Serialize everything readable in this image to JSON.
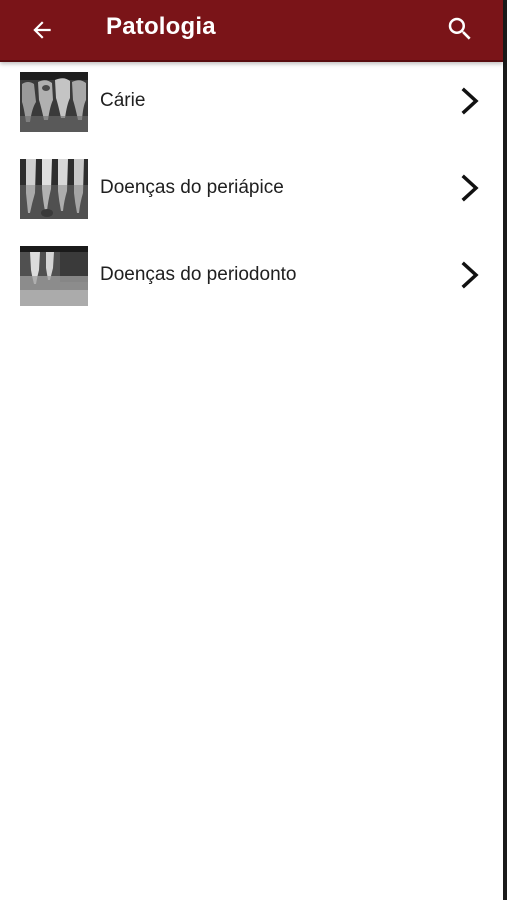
{
  "header": {
    "title": "Patologia",
    "back_icon": "arrow-left-icon",
    "search_icon": "search-icon"
  },
  "list": {
    "items": [
      {
        "label": "Cárie",
        "thumbnail": "xray-caries-thumbnail"
      },
      {
        "label": "Doenças do periápice",
        "thumbnail": "xray-periapex-thumbnail"
      },
      {
        "label": "Doenças do periodonto",
        "thumbnail": "xray-periodontium-thumbnail"
      }
    ]
  },
  "colors": {
    "appbar": "#7a1418",
    "text": "#202020",
    "background": "#ffffff"
  }
}
